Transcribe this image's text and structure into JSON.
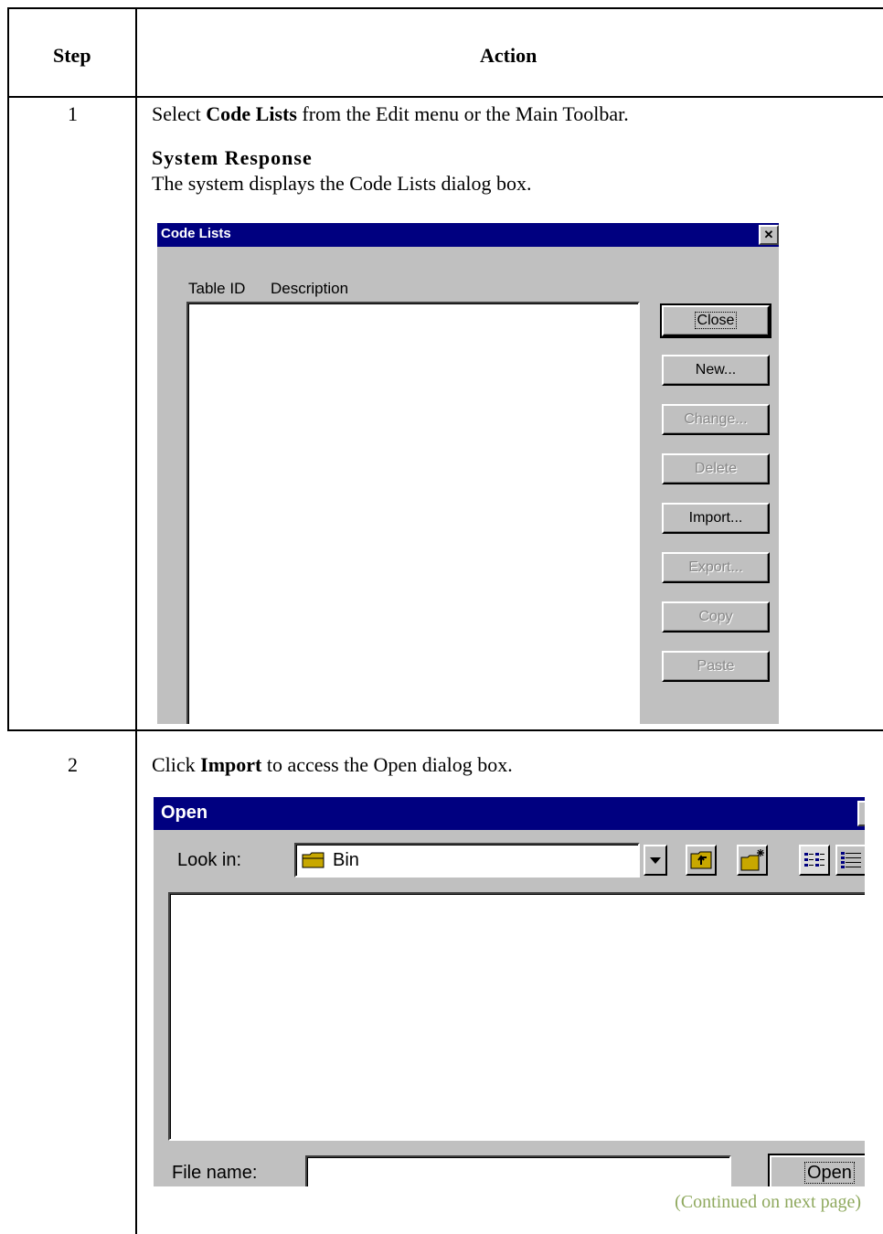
{
  "table": {
    "header_step": "Step",
    "header_action": "Action"
  },
  "row1": {
    "step": "1",
    "text_before": "Select ",
    "text_bold": "Code Lists",
    "text_after": " from the Edit menu or the Main Toolbar.",
    "system_response_heading": "System Response",
    "system_response_text": "The system displays the Code Lists dialog box."
  },
  "code_lists_dialog": {
    "title": "Code Lists",
    "close_x": "✕",
    "col_table_id": "Table ID",
    "col_description": "Description",
    "buttons": {
      "close": "Close",
      "new": "New...",
      "change": "Change...",
      "delete": "Delete",
      "import": "Import...",
      "export": "Export...",
      "copy": "Copy",
      "paste": "Paste"
    }
  },
  "row2": {
    "step": "2",
    "text_before": "Click ",
    "text_bold": "Import",
    "text_after": " to access the Open dialog box."
  },
  "open_dialog": {
    "title": "Open",
    "look_in_label": "Look in:",
    "look_in_value": "Bin",
    "file_name_label": "File name:",
    "file_name_value": "",
    "open_button": "Open"
  },
  "footer": {
    "continued": "(Continued on next page)"
  },
  "colors": {
    "titlebar": "#000080",
    "dialog_face": "#c0c0c0",
    "continued_text": "#8fa95e"
  },
  "icons": [
    "folder-icon",
    "dropdown-arrow-icon",
    "up-one-level-icon",
    "new-folder-icon",
    "list-view-icon",
    "details-view-icon"
  ]
}
